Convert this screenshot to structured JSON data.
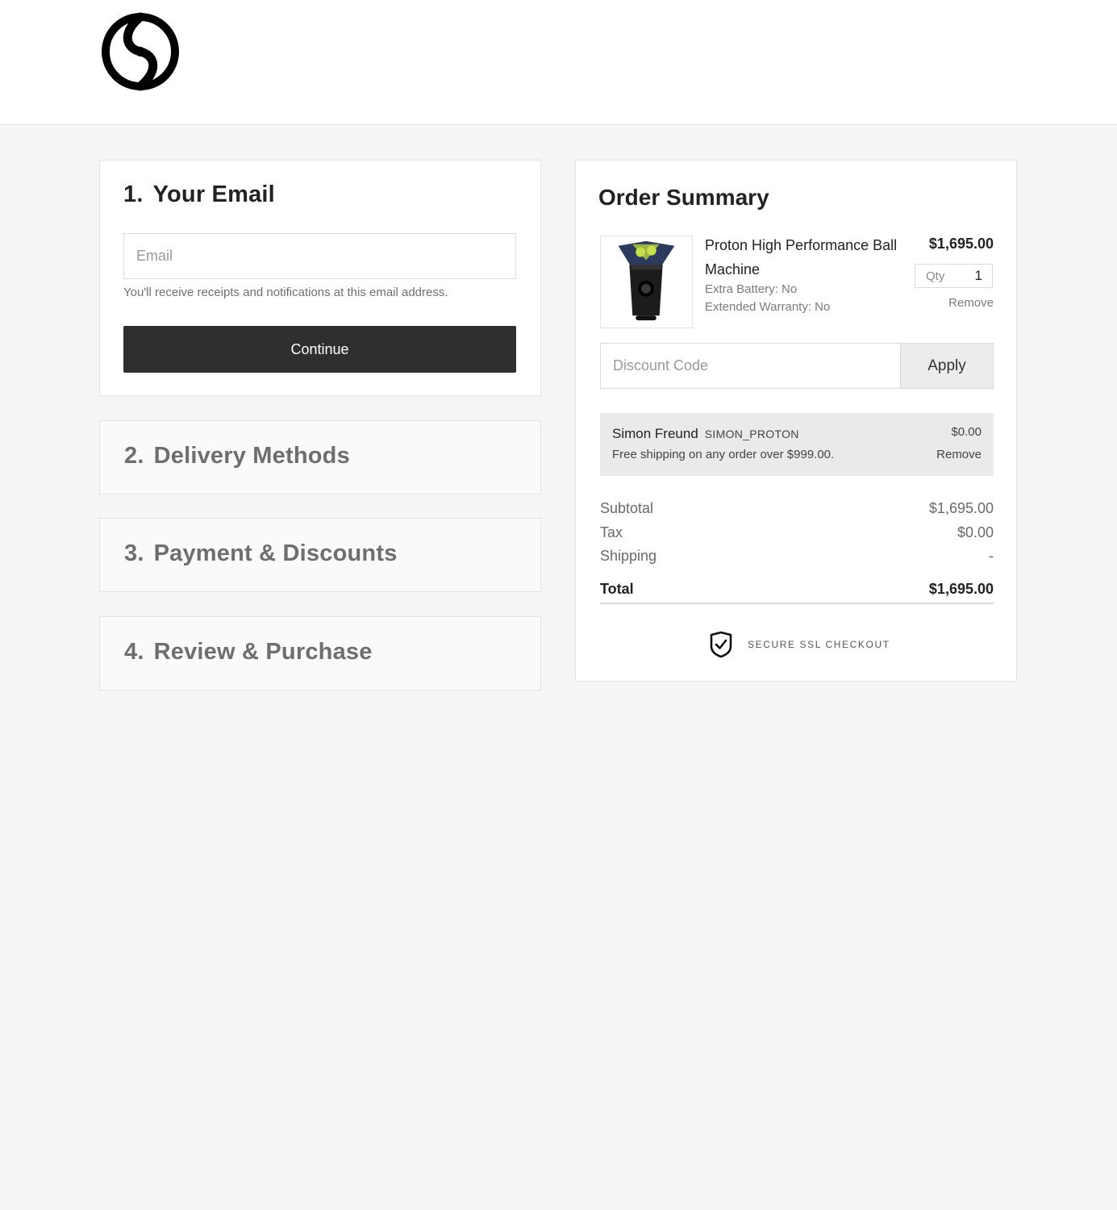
{
  "brand": {
    "logo_icon": "swirl-logo-icon"
  },
  "steps": [
    {
      "number": "1.",
      "title": "Your Email",
      "state": "active"
    },
    {
      "number": "2.",
      "title": "Delivery Methods",
      "state": "collapsed"
    },
    {
      "number": "3.",
      "title": "Payment & Discounts",
      "state": "collapsed"
    },
    {
      "number": "4.",
      "title": "Review & Purchase",
      "state": "collapsed"
    }
  ],
  "email_step": {
    "placeholder": "Email",
    "value": "",
    "hint": "You'll receive receipts and notifications at this email address.",
    "continue_label": "Continue"
  },
  "order_summary": {
    "title": "Order Summary",
    "item": {
      "name": "Proton High Performance Ball Machine",
      "price": "$1,695.00",
      "options": [
        "Extra Battery: No",
        "Extended Warranty: No"
      ],
      "qty_label": "Qty",
      "qty": "1",
      "remove_label": "Remove",
      "image_icon": "ball-machine-product-image"
    },
    "discount": {
      "placeholder": "Discount Code",
      "apply_label": "Apply"
    },
    "applied_promo": {
      "name": "Simon Freund",
      "code": "SIMON_PROTON",
      "description": "Free shipping on any order over $999.00.",
      "amount": "$0.00",
      "remove_label": "Remove"
    },
    "totals": {
      "subtotal_label": "Subtotal",
      "subtotal": "$1,695.00",
      "tax_label": "Tax",
      "tax": "$0.00",
      "shipping_label": "Shipping",
      "shipping": "-",
      "total_label": "Total",
      "total": "$1,695.00"
    },
    "secure_label": "SECURE SSL CHECKOUT",
    "secure_icon": "shield-check-icon"
  },
  "colors": {
    "button_dark": "#2f2f2f",
    "page_bg": "#f5f5f5",
    "promo_bg": "#eaeaea"
  }
}
